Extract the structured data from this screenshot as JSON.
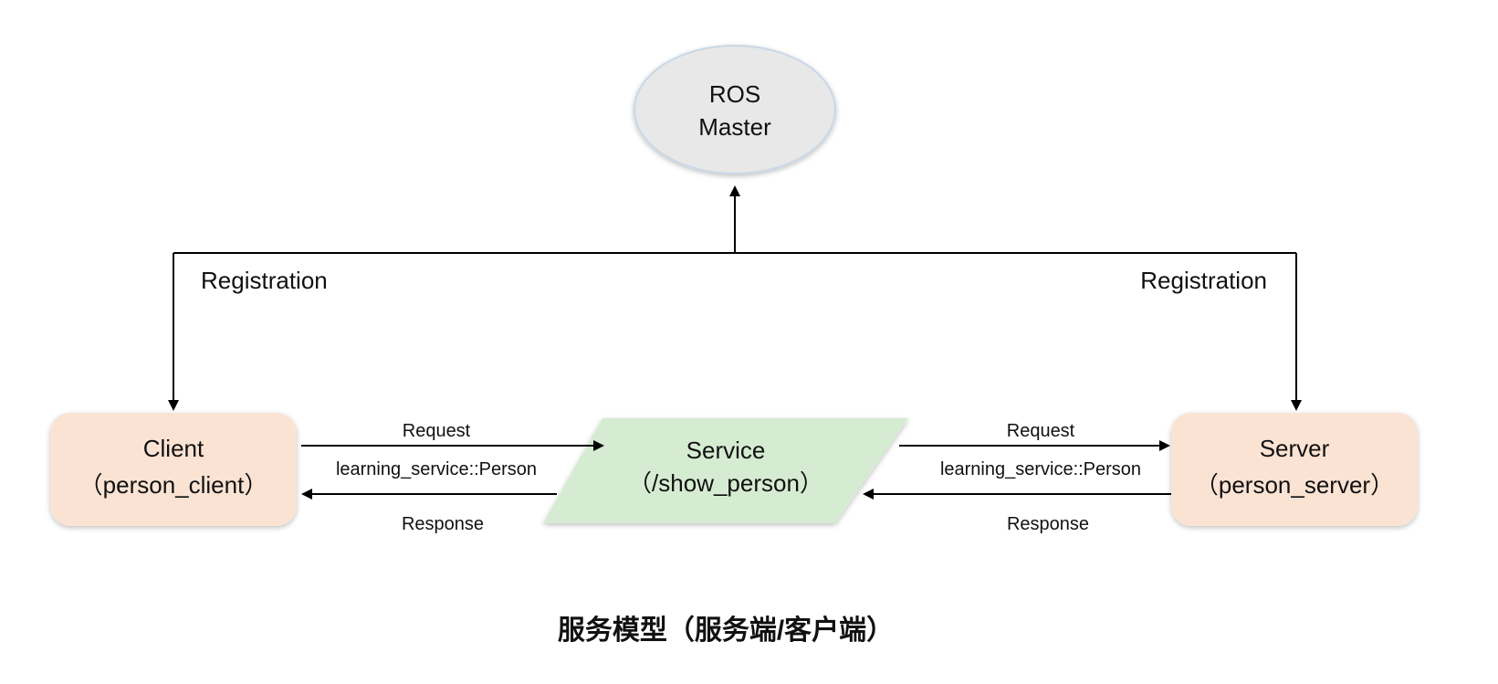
{
  "master": {
    "line1": "ROS",
    "line2": "Master"
  },
  "client": {
    "line1": "Client",
    "line2": "（person_client）"
  },
  "service": {
    "line1": "Service",
    "line2": "（/show_person）"
  },
  "server": {
    "line1": "Server",
    "line2": "（person_server）"
  },
  "edges": {
    "registration_left": "Registration",
    "registration_right": "Registration",
    "request_left": "Request",
    "type_left": "learning_service::Person",
    "response_left": "Response",
    "request_right": "Request",
    "type_right": "learning_service::Person",
    "response_right": "Response"
  },
  "caption": "服务模型（服务端/客户端）",
  "colors": {
    "master_fill": "#e8e8e8",
    "client_fill": "#fbe3d4",
    "server_fill": "#fbe3d4",
    "service_fill": "#d6ecd2",
    "line": "#000000"
  }
}
